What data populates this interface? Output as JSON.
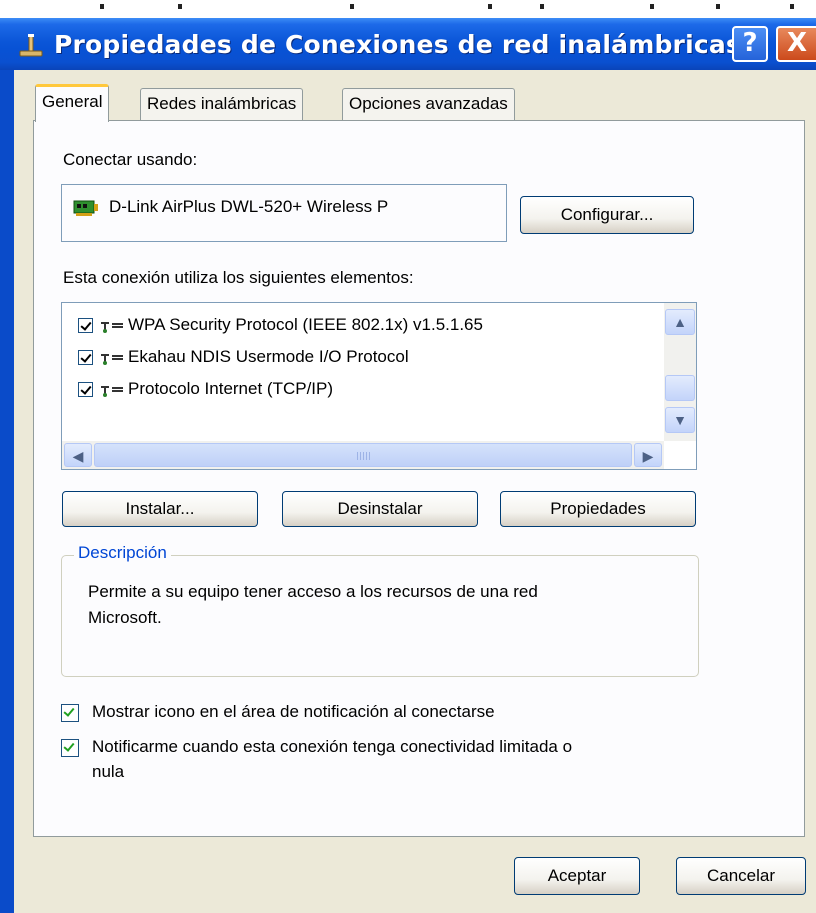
{
  "window": {
    "title": "Propiedades de Conexiones de red inalámbricas",
    "help_label": "?",
    "close_label": "X"
  },
  "tabs": [
    {
      "label": "General",
      "active": true
    },
    {
      "label": "Redes inalámbricas",
      "active": false
    },
    {
      "label": "Opciones avanzadas",
      "active": false
    }
  ],
  "general": {
    "connect_using_label": "Conectar usando:",
    "adapter_name": "D-Link AirPlus DWL-520+ Wireless P",
    "configure_button": "Configurar...",
    "components_label": "Esta conexión utiliza los siguientes elementos:",
    "components": [
      {
        "label": "WPA Security Protocol (IEEE 802.1x) v1.5.1.65",
        "checked": true
      },
      {
        "label": "Ekahau NDIS Usermode I/O Protocol",
        "checked": true
      },
      {
        "label": "Protocolo Internet (TCP/IP)",
        "checked": true
      }
    ],
    "install_button": "Instalar...",
    "uninstall_button": "Desinstalar",
    "properties_button": "Propiedades",
    "description_title": "Descripción",
    "description_text_line1": "Permite a su equipo tener acceso a los recursos de una red",
    "description_text_line2": "Microsoft.",
    "show_icon_label": "Mostrar icono en el área de notificación al conectarse",
    "show_icon_checked": true,
    "notify_label_line1": "Notificarme cuando esta conexión tenga conectividad limitada o",
    "notify_label_line2": "nula",
    "notify_checked": true
  },
  "footer": {
    "ok_button": "Aceptar",
    "cancel_button": "Cancelar"
  },
  "colors": {
    "titlebar": "#0852d5",
    "dialog_bg": "#ece9d8",
    "group_title": "#0046d5",
    "checkbox_green": "#21a121",
    "active_tab_accent": "#ffc83c"
  },
  "icons": {
    "title": "network-connection-icon",
    "adapter": "network-card-icon",
    "component": "protocol-icon"
  }
}
